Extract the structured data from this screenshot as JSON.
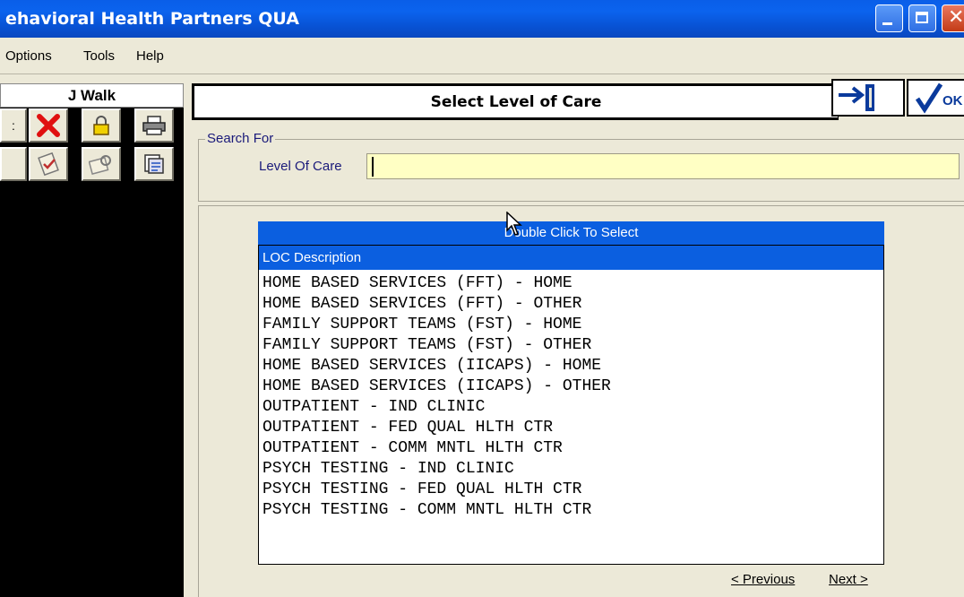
{
  "window": {
    "title": "ehavioral Health Partners QUA",
    "controls": [
      "minimize-icon",
      "maximize-icon",
      "close-icon"
    ]
  },
  "menu": {
    "items": [
      {
        "label": "Options"
      },
      {
        "label": "Tools"
      },
      {
        "label": "Help"
      }
    ]
  },
  "sidebar": {
    "user_name": "J Walk",
    "toolbar_icons": [
      "delete-icon",
      "lock-icon",
      "print-icon",
      "checklist-icon",
      "search-tool-icon",
      "report-icon"
    ]
  },
  "header": {
    "title": "Select Level of Care",
    "exit_icon": "exit-icon",
    "ok_label": "OK"
  },
  "search": {
    "group_label": "Search For",
    "field_label": "Level Of Care",
    "value": ""
  },
  "list": {
    "instruction": "Double Click To Select",
    "column_header": "LOC Description",
    "rows": [
      "HOME BASED SERVICES (FFT) - HOME",
      "HOME BASED SERVICES (FFT) - OTHER",
      "FAMILY SUPPORT TEAMS (FST) - HOME",
      "FAMILY SUPPORT TEAMS (FST) - OTHER",
      "HOME BASED SERVICES (IICAPS) - HOME",
      "HOME BASED SERVICES (IICAPS) - OTHER",
      "OUTPATIENT - IND CLINIC",
      "OUTPATIENT - FED QUAL HLTH CTR",
      "OUTPATIENT - COMM MNTL HLTH CTR",
      "PSYCH TESTING - IND CLINIC",
      "PSYCH TESTING - FED QUAL HLTH CTR",
      "PSYCH TESTING - COMM MNTL HLTH CTR"
    ]
  },
  "pager": {
    "previous_label": "< Previous",
    "next_label": "Next >"
  },
  "colors": {
    "titlebar": "#0b5fe0",
    "input_bg": "#ffffc4",
    "list_header": "#0b5fe0",
    "delete_red": "#e01010"
  }
}
